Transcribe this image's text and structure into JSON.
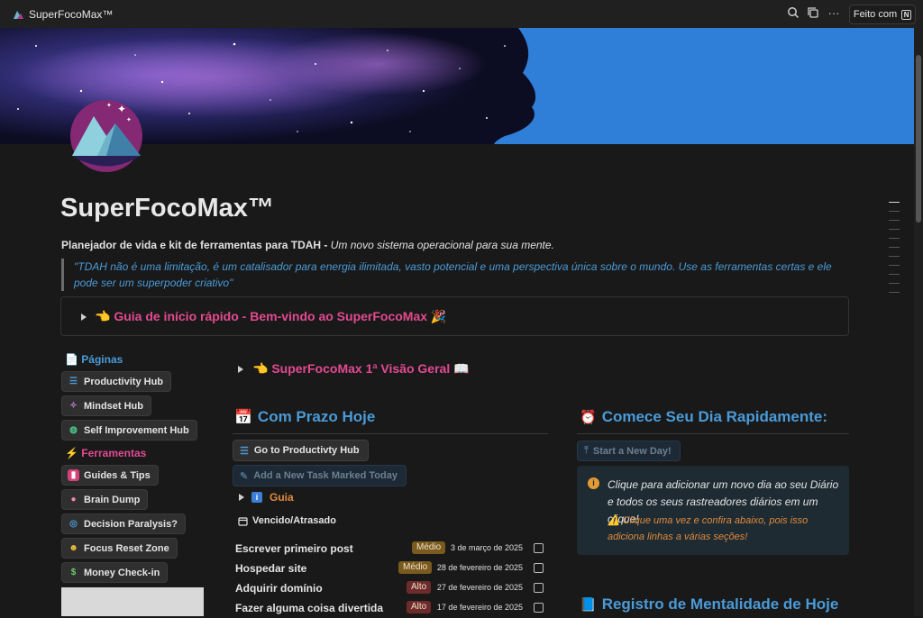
{
  "topbar": {
    "app_title": "SuperFocoMax™",
    "made_with": "Feito com",
    "icons": [
      "search-icon",
      "duplicate-icon",
      "more-icon",
      "notion-icon"
    ]
  },
  "page": {
    "title": "SuperFocoMax™",
    "subtitle_bold": "Planejador de vida e kit de ferramentas para TDAH - ",
    "subtitle_italic": "Um novo sistema operacional para sua mente.",
    "quote": "\"TDAH não é uma limitação, é um catalisador para energia ilimitada, vasto potencial e uma perspectiva única sobre o mundo. Use as ferramentas certas e ele pode ser um superpoder criativo\"",
    "quickstart": "👈 Guia de início rápido - Bem-vindo ao SuperFocoMax 🎉"
  },
  "sidebar": {
    "pages_header": "Páginas",
    "pages": [
      {
        "label": "Productivity Hub",
        "icon": "list-icon"
      },
      {
        "label": "Mindset Hub",
        "icon": "sparkles-icon"
      },
      {
        "label": "Self Improvement Hub",
        "icon": "globe-icon"
      }
    ],
    "tools_header": "Ferramentas",
    "tools": [
      {
        "label": "Guides & Tips",
        "icon": "book-icon"
      },
      {
        "label": "Brain Dump",
        "icon": "brain-icon"
      },
      {
        "label": "Decision Paralysis?",
        "icon": "spiral-icon"
      },
      {
        "label": "Focus Reset Zone",
        "icon": "face-icon"
      },
      {
        "label": "Money Check-in",
        "icon": "money-icon"
      }
    ]
  },
  "overview": "👈 SuperFocoMax 1ª Visão Geral 📖",
  "due_today": {
    "header": "Com Prazo Hoje",
    "go_hub": "Go to Productivty Hub",
    "add_task": "Add a New Task Marked Today",
    "guia": "Guia",
    "overdue": "Vencido/Atrasado",
    "tasks": [
      {
        "name": "Escrever primeiro post",
        "priority": "Médio",
        "date": "3 de março de 2025",
        "color": "#7a5a1e"
      },
      {
        "name": "Hospedar site",
        "priority": "Médio",
        "date": "28 de fevereiro de 2025",
        "color": "#7a5a1e"
      },
      {
        "name": "Adquirir domínio",
        "priority": "Alto",
        "date": "27 de fevereiro de 2025",
        "color": "#6e2b2b"
      },
      {
        "name": "Fazer alguma coisa divertida",
        "priority": "Alto",
        "date": "17 de fevereiro de 2025",
        "color": "#6e2b2b"
      }
    ]
  },
  "quick_start": {
    "header": "Comece Seu Dia Rapidamente:",
    "new_day": "Start a New Day!",
    "callout_text": "Clique para adicionar um novo dia ao seu Diário e todos os seus rastreadores diários em um clique!",
    "callout_warn": "⚠️ Clique uma vez e confira abaixo, pois isso adiciona linhas a várias seções!"
  },
  "mindset": {
    "header": "Registro de Mentalidade de Hoje"
  },
  "colors": {
    "accent_blue": "#4a9bd8",
    "accent_pink": "#e34a91",
    "accent_orange": "#e08a3c",
    "background": "#191919"
  }
}
